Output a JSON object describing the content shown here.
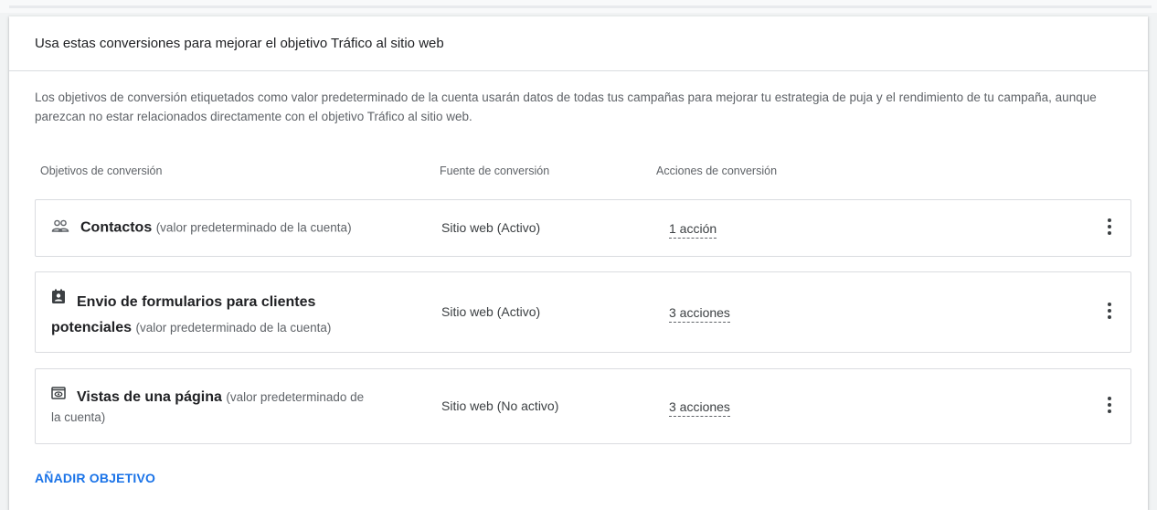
{
  "card": {
    "title": "Usa estas conversiones para mejorar el objetivo Tráfico al sitio web",
    "description": "Los objetivos de conversión etiquetados como valor predeterminado de la cuenta usarán datos de todas tus campañas para mejorar tu estrategia de puja y el rendimiento de tu campaña, aunque parezcan no estar relacionados directamente con el objetivo Tráfico al sitio web."
  },
  "columns": {
    "goals": "Objetivos de conversión",
    "source": "Fuente de conversión",
    "actions": "Acciones de conversión"
  },
  "goals": [
    {
      "icon": "people-icon",
      "name": "Contactos",
      "suffix": "(valor predeterminado de la cuenta)",
      "source": "Sitio web (Activo)",
      "actions": "1 acción"
    },
    {
      "icon": "contact-form-icon",
      "name": "Envio de formularios para clientes potenciales",
      "name_line1": "Envio de formularios para clientes",
      "name_line2": "potenciales",
      "suffix": "(valor predeterminado de la cuenta)",
      "source": "Sitio web (Activo)",
      "actions": "3 acciones"
    },
    {
      "icon": "page-view-icon",
      "name": "Vistas de una página",
      "suffix": "(valor predeterminado de",
      "suffix_line2": "la cuenta)",
      "source": "Sitio web (No activo)",
      "actions": "3 acciones"
    }
  ],
  "add_goal_label": "AÑADIR OBJETIVO"
}
